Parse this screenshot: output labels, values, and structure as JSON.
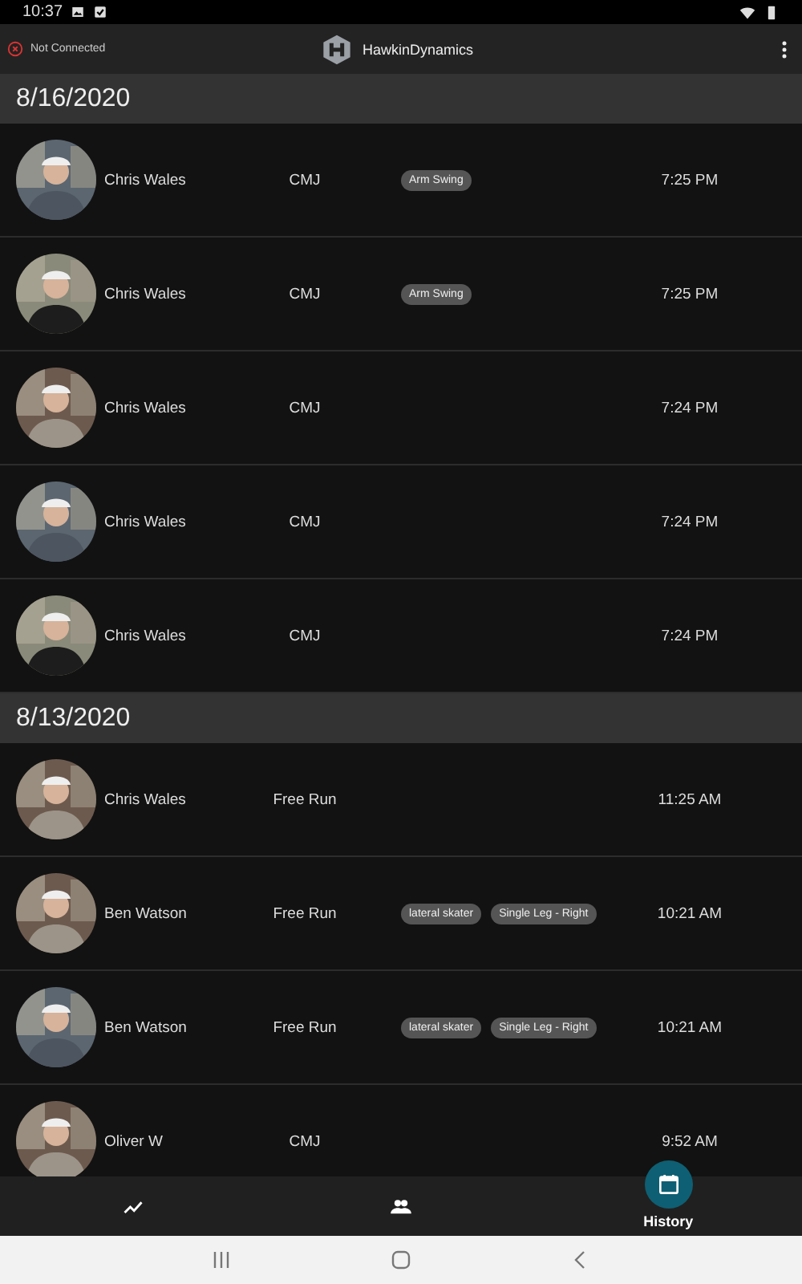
{
  "status_bar": {
    "time": "10:37"
  },
  "app_bar": {
    "connection": "Not Connected",
    "connected": false,
    "title": "HawkinDynamics"
  },
  "sections": [
    {
      "date": "8/16/2020",
      "rows": [
        {
          "name": "Chris Wales",
          "test": "CMJ",
          "tags": [
            "Arm Swing"
          ],
          "time": "7:25 PM"
        },
        {
          "name": "Chris Wales",
          "test": "CMJ",
          "tags": [
            "Arm Swing"
          ],
          "time": "7:25 PM"
        },
        {
          "name": "Chris Wales",
          "test": "CMJ",
          "time": "7:24 PM"
        },
        {
          "name": "Chris Wales",
          "test": "CMJ",
          "time": "7:24 PM"
        },
        {
          "name": "Chris Wales",
          "test": "CMJ",
          "time": "7:24 PM"
        }
      ]
    },
    {
      "date": "8/13/2020",
      "rows": [
        {
          "name": "Chris Wales",
          "test": "Free Run",
          "time": "11:25 AM"
        },
        {
          "name": "Ben Watson",
          "test": "Free Run",
          "tags": [
            "lateral skater",
            "Single Leg - Right"
          ],
          "time": "10:21 AM"
        },
        {
          "name": "Ben Watson",
          "test": "Free Run",
          "tags": [
            "lateral skater",
            "Single Leg - Right"
          ],
          "time": "10:21 AM"
        },
        {
          "name": "Oliver W",
          "test": "CMJ",
          "time": "9:52 AM"
        }
      ]
    }
  ],
  "bottom_nav": [
    {
      "kind": "trend",
      "selected": false
    },
    {
      "kind": "people",
      "selected": false
    },
    {
      "kind": "calendar",
      "label": "History",
      "selected": true
    }
  ]
}
